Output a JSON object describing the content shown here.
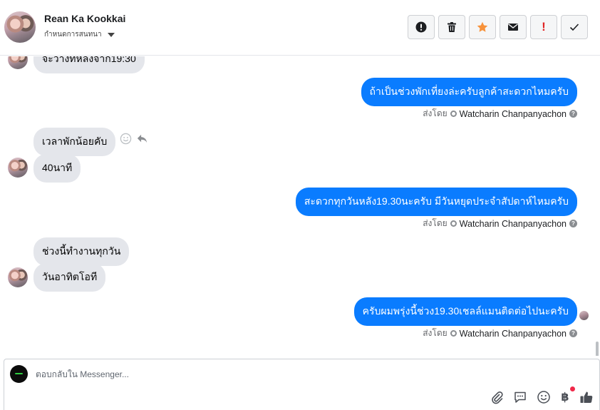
{
  "header": {
    "contact_name": "Rean Ka Kookkai",
    "status_label": "กำหนดการสนทนา",
    "actions": [
      {
        "icon": "alert-circle-icon"
      },
      {
        "icon": "trash-icon"
      },
      {
        "icon": "star-icon",
        "color": "#f7923b"
      },
      {
        "icon": "envelope-icon"
      },
      {
        "icon": "exclamation-icon",
        "label": "!",
        "color": "#e02424"
      },
      {
        "icon": "checkmark-icon"
      }
    ]
  },
  "messages": {
    "in_1": "จะว่างทีหลังจาก19:30",
    "out_1": "ถ้าเป็นช่วงพักเที่ยงล่ะครับลูกค้าสะดวกไหมครับ",
    "in_2": "เวลาพักน้อยคับ",
    "in_3": "40นาที",
    "out_2": "สะดวกทุกวันหลัง19.30นะครับ มีวันหยุดประจำสัปดาห์ไหมครับ",
    "in_4": "ช่วงนี้ทำงานทุกวัน",
    "in_5": "วันอาทิตโอที",
    "out_3": "ครับผมพรุ่งนี้ช่วง19.30เชลล์แมนติดต่อไปนะครับ",
    "sent_by_label": "ส่งโดย",
    "sender_name": "Watcharin Chanpanyachon",
    "help_glyph": "?"
  },
  "composer": {
    "placeholder": "ตอบกลับใน Messenger...",
    "currency_glyph": "฿"
  },
  "colors": {
    "outgoing_bubble": "#0a7cff",
    "incoming_bubble": "#e4e6eb",
    "accent_star": "#f7923b",
    "alert_red": "#e02424"
  }
}
